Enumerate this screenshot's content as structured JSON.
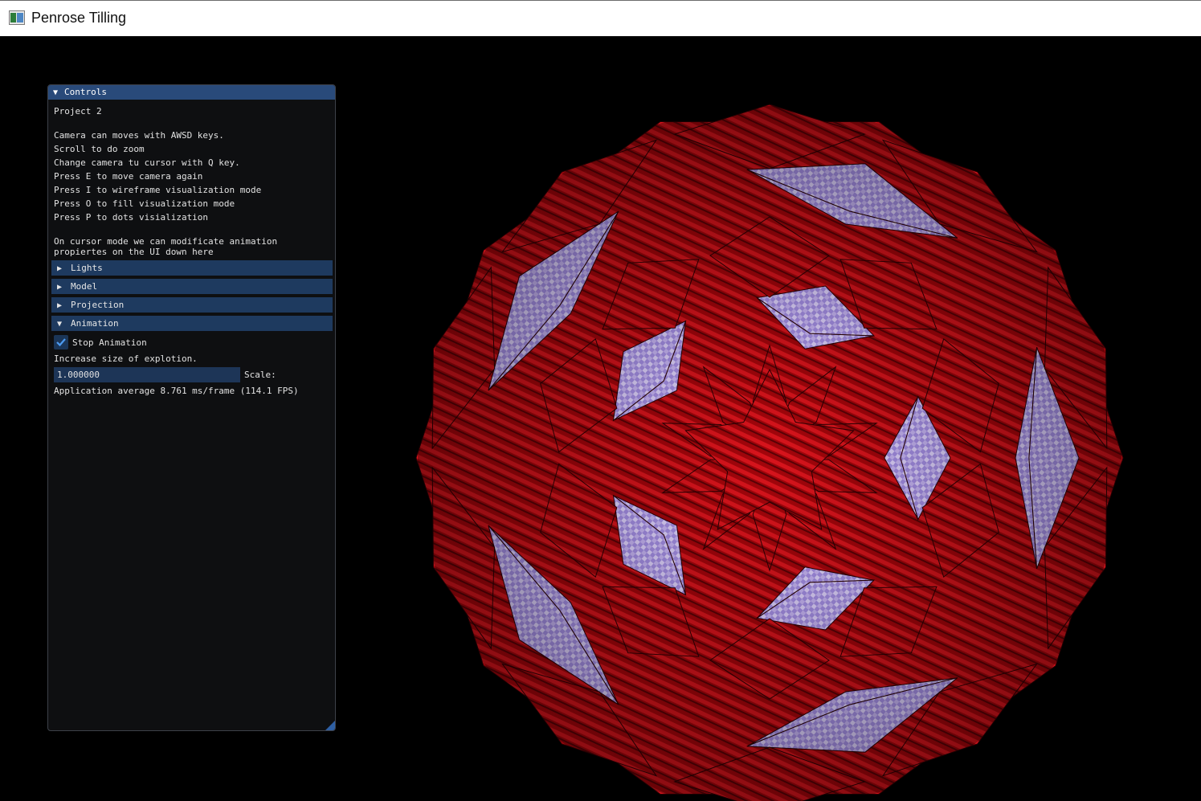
{
  "window": {
    "title": "Penrose Tilling"
  },
  "controls": {
    "header": "Controls",
    "project": "Project 2",
    "instructions": [
      "Camera can moves with AWSD keys.",
      "Scroll to do zoom",
      "Change camera tu cursor with Q key.",
      "Press E to move camera again",
      "Press I to wireframe visualization mode",
      "Press O to fill visualization mode",
      "Press P to dots visialization"
    ],
    "cursor_note": [
      "On cursor mode we can modificate animation",
      "propiertes on the UI down here"
    ],
    "sections": [
      {
        "label": "Lights",
        "expanded": false
      },
      {
        "label": "Model",
        "expanded": false
      },
      {
        "label": "Projection",
        "expanded": false
      },
      {
        "label": "Animation",
        "expanded": true
      }
    ],
    "animation": {
      "stop_label": "Stop Animation",
      "stop_checked": true,
      "increase_label": "Increase size of explotion.",
      "scale_value": "1.000000",
      "scale_label": "Scale:"
    },
    "stats": "Application average 8.761 ms/frame (114.1 FPS)"
  },
  "colors": {
    "kite_red": "#b8050c",
    "dart_lavender": "#b9a2f0",
    "header_blue": "#294a7a",
    "section_blue": "#1e3a5f"
  }
}
